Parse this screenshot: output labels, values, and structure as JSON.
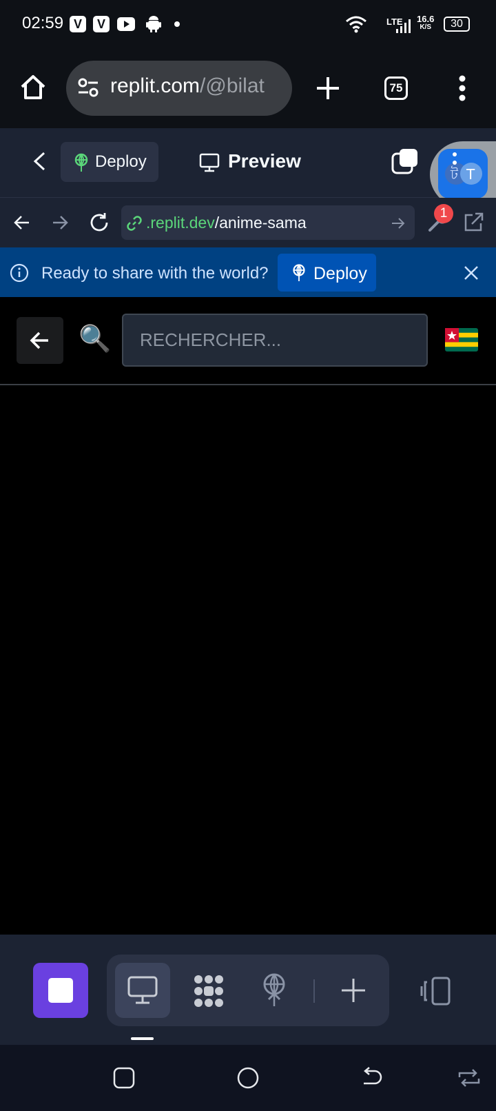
{
  "status_bar": {
    "time": "02:59",
    "network_label": "LTE",
    "speed_value": "16.6",
    "speed_unit": "K/S",
    "battery": "30",
    "app_icons": [
      "vivaldi-icon",
      "vivaldi-icon",
      "youtube-icon",
      "android-icon",
      "dot-icon"
    ]
  },
  "browser": {
    "url_host": "replit.com",
    "url_path": "/@bilat",
    "tab_count": "75"
  },
  "replit_header": {
    "deploy_label": "Deploy",
    "preview_label": "Preview"
  },
  "preview_bar": {
    "url_host": ".replit.dev",
    "url_path": "/anime-sama",
    "notification_count": "1"
  },
  "banner": {
    "message": "Ready to share with the world?",
    "deploy_label": "Deploy"
  },
  "app": {
    "search_placeholder": "RECHERCHER...",
    "search_emoji": "🔍",
    "flag_name": "togo-flag"
  },
  "colors": {
    "replit_bg": "#1c2333",
    "banner_bg": "#004182",
    "accent_green": "#5bd67a",
    "stop_button": "#6a40e0",
    "badge_red": "#f0484b"
  }
}
